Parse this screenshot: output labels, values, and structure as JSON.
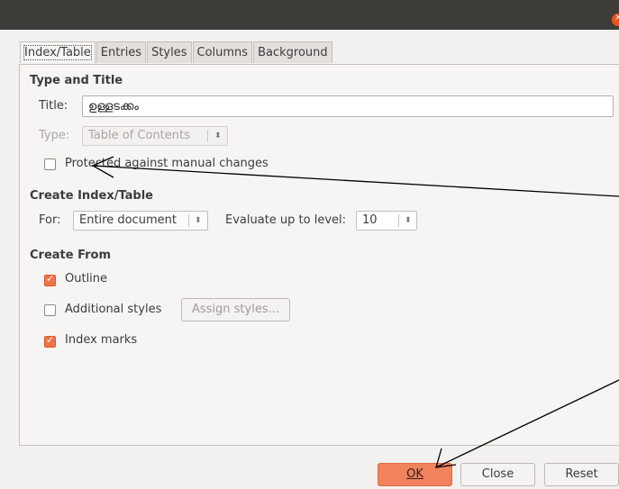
{
  "window": {
    "close_glyph": "×"
  },
  "tabs": [
    {
      "label": "Index/Table"
    },
    {
      "label": "Entries"
    },
    {
      "label": "Styles"
    },
    {
      "label": "Columns"
    },
    {
      "label": "Background"
    }
  ],
  "type_and_title": {
    "heading": "Type and Title",
    "title_label": "Title:",
    "title_value": "ഉള്ളടക്കം",
    "type_label": "Type:",
    "type_value": "Table of Contents",
    "protected_label": "Protected against manual changes",
    "protected_checked": false
  },
  "create_index": {
    "heading": "Create Index/Table",
    "for_label": "For:",
    "for_value": "Entire document",
    "evaluate_label": "Evaluate up to level:",
    "level_value": "10"
  },
  "create_from": {
    "heading": "Create From",
    "outline_label": "Outline",
    "outline_checked": true,
    "additional_label": "Additional styles",
    "additional_checked": false,
    "assign_label": "Assign styles...",
    "index_marks_label": "Index marks",
    "index_marks_checked": true
  },
  "buttons": {
    "ok": "OK",
    "close": "Close",
    "reset": "Reset"
  },
  "colors": {
    "accent": "#f0825c",
    "titlebar": "#3d3c38"
  }
}
